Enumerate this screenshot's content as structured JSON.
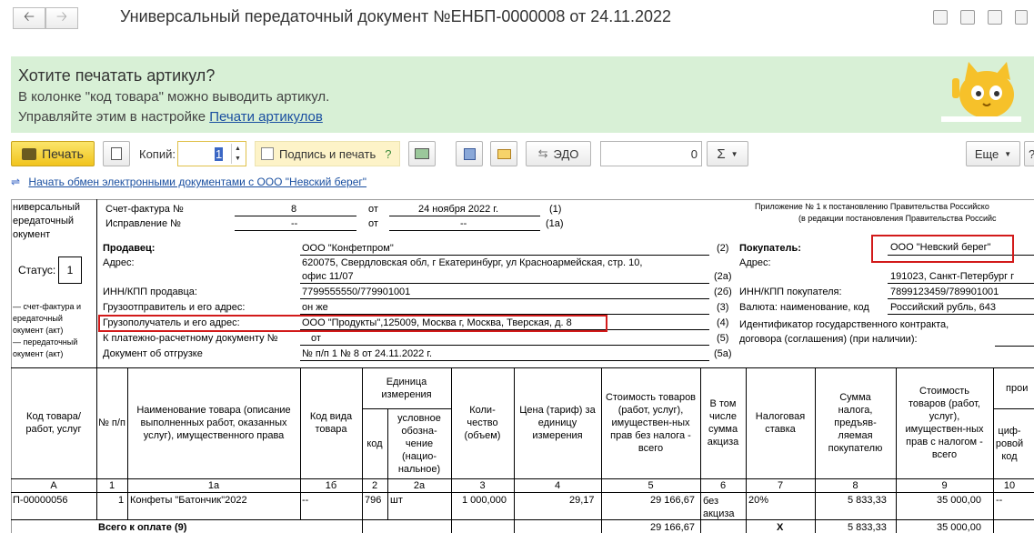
{
  "header": {
    "title": "Универсальный передаточный документ №ЕНБП-0000008 от 24.11.2022",
    "back_icon": "arrow-left-icon",
    "forward_icon": "arrow-right-icon"
  },
  "banner": {
    "title": "Хотите печатать артикул?",
    "line1": "В колонке \"код товара\" можно выводить артикул.",
    "line2_prefix": "Управляйте этим в настройке ",
    "line2_link": "Печати артикулов"
  },
  "toolbar": {
    "print_label": "Печать",
    "copies_label": "Копий:",
    "copies_value": "1",
    "sign_label": "Подпись и печать",
    "sign_help": "?",
    "edo_label": "ЭДО",
    "amount_value": "0",
    "sigma_label": "Σ",
    "more_label": "Еще",
    "help_label": "?"
  },
  "exchange_link": "Начать обмен электронными документами с ООО \"Невский берег\"",
  "doc": {
    "left_title": [
      "ниверсальный",
      "ередаточный",
      "окумент"
    ],
    "status_label": "Статус:",
    "status_value": "1",
    "status_notes": [
      "— счет-фактура и",
      "ередаточный",
      "окумент (акт)",
      "— передаточный",
      "окумент (акт)"
    ],
    "appendix1": "Приложение № 1 к постановлению Правительства Российско",
    "appendix2": "(в редакции постановления Правительства Российс",
    "invoice_label": "Счет-фактура №",
    "invoice_no": "8",
    "from": "от",
    "invoice_date": "24 ноября 2022 г.",
    "invoice_code": "(1)",
    "correction_label": "Исправление №",
    "correction_no": "--",
    "correction_date": "--",
    "correction_code": "(1а)",
    "seller_label": "Продавец:",
    "seller_value": "ООО \"Конфетпром\"",
    "seller_code": "(2)",
    "address_label": "Адрес:",
    "address_value1": "620075, Свердловская обл, г Екатеринбург, ул Красноармейская, стр. 10,",
    "address_value2": "офис 11/07",
    "address_code": "(2а)",
    "inn_label": "ИНН/КПП продавца:",
    "inn_value": "7799555550/779901001",
    "inn_code": "(2б)",
    "shipper_label": "Грузоотправитель и его адрес:",
    "shipper_value": "он же",
    "shipper_code": "(3)",
    "consignee_label": "Грузополучатель и его адрес:",
    "consignee_value": "ООО \"Продукты\",125009, Москва г, Москва, Тверская, д. 8",
    "consignee_code": "(4)",
    "payment_label": "К платежно-расчетному документу №",
    "payment_value": "от",
    "payment_code": "(5)",
    "shipment_label": "Документ об отгрузке",
    "shipment_value": "№ п/п 1 № 8 от 24.11.2022 г.",
    "shipment_code": "(5а)",
    "buyer_label": "Покупатель:",
    "buyer_value": "ООО \"Невский берег\"",
    "buyer_address_label": "Адрес:",
    "buyer_address_value": "191023, Санкт-Петербург г",
    "buyer_inn_label": "ИНН/КПП покупателя:",
    "buyer_inn_value": "7899123459/789901001",
    "currency_label": "Валюта: наименование, код",
    "currency_value": "Российский рубль, 643",
    "contract_label1": "Идентификатор государственного контракта,",
    "contract_label2": "договора (соглашения) (при наличии):"
  },
  "table": {
    "headers": {
      "code": "Код товара/ работ, услуг",
      "num": "№ п/п",
      "name": "Наименование товара (описание выполненных работ, оказанных услуг), имущественного права",
      "kind": "Код вида товара",
      "unit": "Единица измерения",
      "unit_code": "код",
      "unit_name": "условное обозна-чение (нацио-нальное)",
      "qty": "Коли-чество (объем)",
      "price": "Цена (тариф) за единицу измерения",
      "cost_no_tax": "Стоимость товаров (работ, услуг), имуществен-ных прав без налога - всего",
      "excise": "В том числе сумма акциза",
      "rate": "Налоговая ставка",
      "tax": "Сумма налога, предъяв-ляемая покупателю",
      "cost_tax": "Стоимость товаров (работ, услуг), имуществен-ных прав с налогом - всего",
      "country_top": "прои",
      "country_code": "циф-ровой код"
    },
    "col_numbers": [
      "А",
      "1",
      "1а",
      "1б",
      "2",
      "2а",
      "3",
      "4",
      "5",
      "6",
      "7",
      "8",
      "9",
      "10"
    ],
    "row": {
      "code": "П-00000056",
      "num": "1",
      "name": "Конфеты \"Батончик\"2022",
      "kind": "--",
      "unit_code": "796",
      "unit_name": "шт",
      "qty": "1 000,000",
      "price": "29,17",
      "cost_no_tax": "29 166,67",
      "excise": "без акциза",
      "rate": "20%",
      "tax": "5 833,33",
      "cost_tax": "35 000,00",
      "country": "--"
    },
    "total": {
      "label": "Всего к оплате (9)",
      "cost_no_tax": "29 166,67",
      "excise": "Х",
      "tax": "5 833,33",
      "cost_tax": "35 000,00"
    }
  }
}
